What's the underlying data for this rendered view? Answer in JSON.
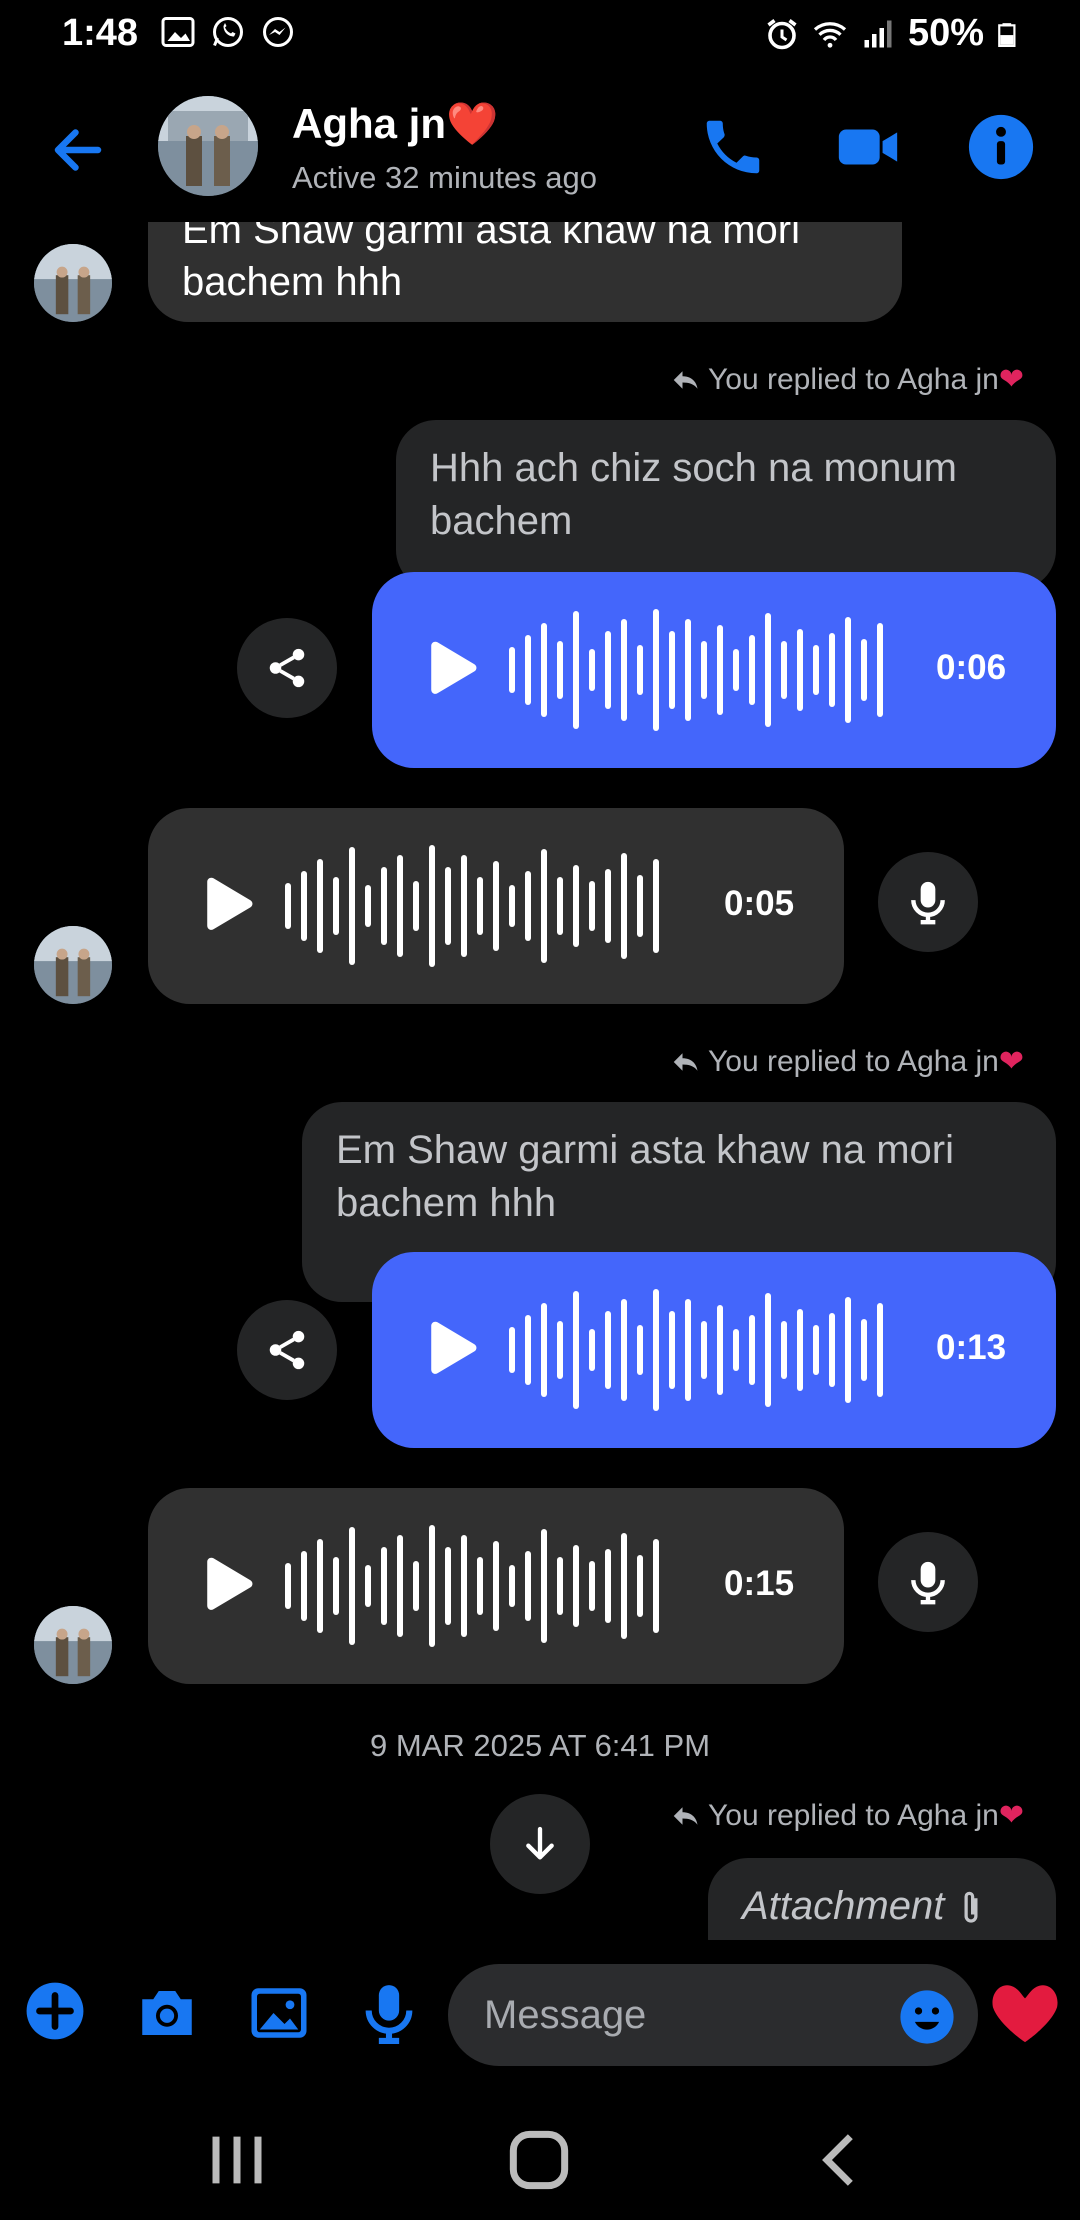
{
  "status_bar": {
    "time": "1:48",
    "battery": "50%",
    "icons_left": [
      "gallery-icon",
      "whatsapp-icon",
      "messenger-icon"
    ],
    "icons_right": [
      "alarm-icon",
      "wifi-icon",
      "signal-icon",
      "battery-icon"
    ]
  },
  "header": {
    "name": "Agha jn",
    "name_emoji": "❤️",
    "status": "Active 32 minutes ago",
    "accent_color": "#1877f2"
  },
  "messages": {
    "top_partial": {
      "line1": "Em Shaw garmi asta khaw na mori",
      "line2": "bachem hhh"
    },
    "reply1": {
      "label": "You replied to Agha jn",
      "quoted": "Hhh ach chiz soch na monum bachem",
      "duration": "0:06"
    },
    "incoming1": {
      "duration": "0:05"
    },
    "reply2": {
      "label": "You replied to Agha jn",
      "quoted": "Em Shaw garmi asta khaw na mori bachem hhh",
      "duration": "0:13"
    },
    "incoming2": {
      "duration": "0:15"
    },
    "timestamp": "9 MAR 2025 AT 6:41 PM",
    "reply3": {
      "label": "You replied to Agha jn",
      "quoted": "Attachment"
    }
  },
  "composer": {
    "placeholder": "Message",
    "icons": [
      "plus-icon",
      "camera-icon",
      "gallery-icon",
      "microphone-icon",
      "emoji-icon",
      "heart-icon"
    ]
  },
  "colors": {
    "outgoing_bubble": "#4466fb",
    "incoming_bubble": "#303030",
    "background": "#000000"
  }
}
